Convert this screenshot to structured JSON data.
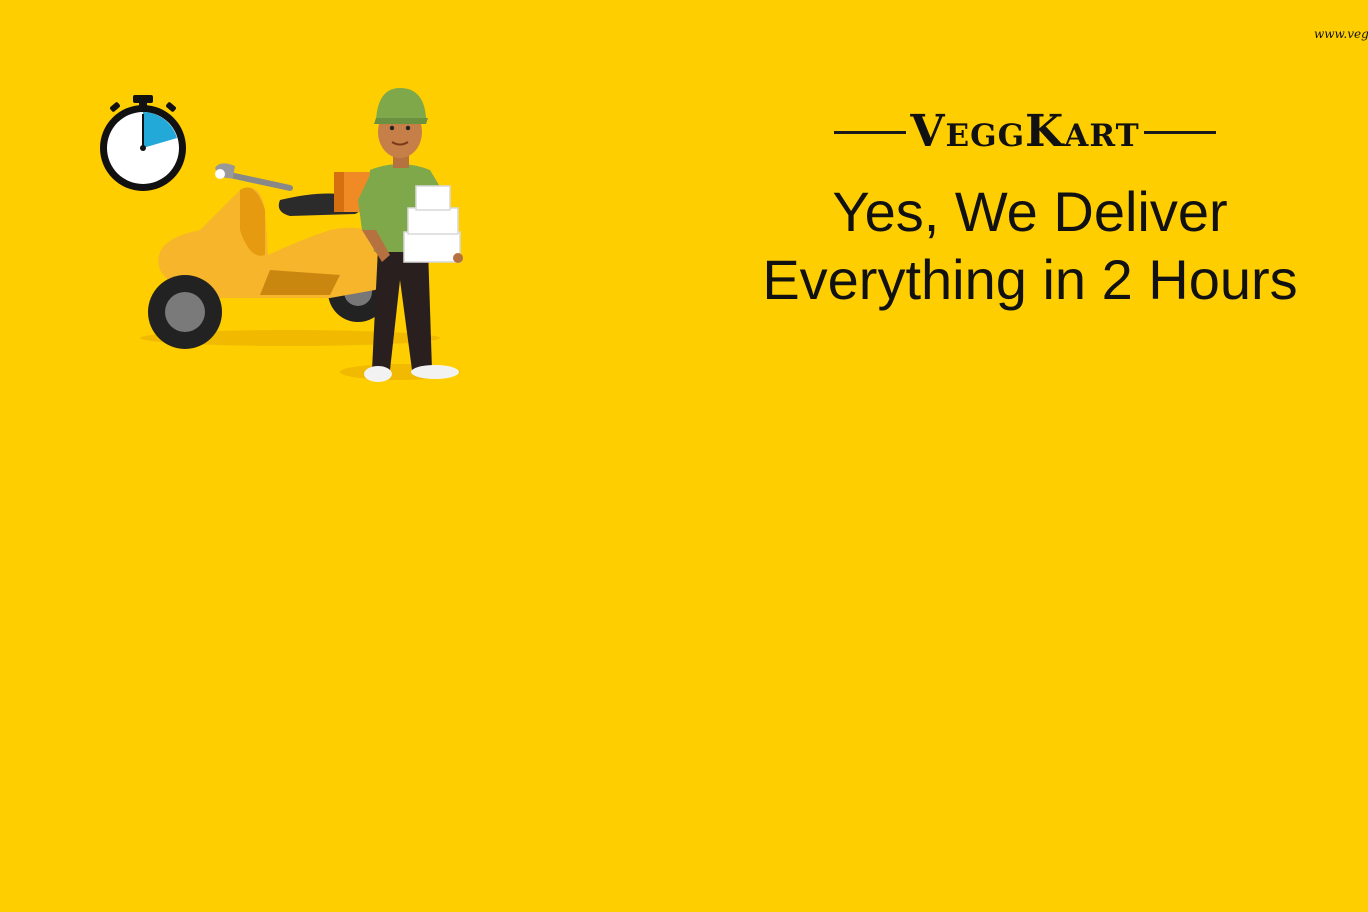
{
  "watermark": {
    "url_fragment": "www.veg"
  },
  "brand": {
    "name": "VeggKart"
  },
  "tagline": {
    "line1": "Yes, We Deliver",
    "line2": "Everything in 2 Hours"
  },
  "colors": {
    "background": "#FFCE00",
    "text": "#111111",
    "timer_accent": "#22A9D8",
    "scooter": "#F6B52A",
    "shirt": "#7FA84A"
  },
  "icons": {
    "timer": "stopwatch-icon",
    "scooter": "scooter-icon",
    "courier": "delivery-man-icon"
  }
}
